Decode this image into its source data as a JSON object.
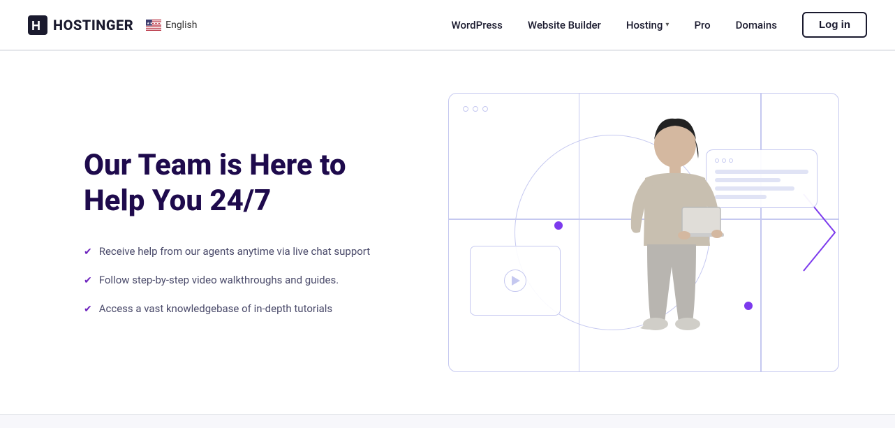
{
  "navbar": {
    "logo_text": "HOSTINGER",
    "language": "English",
    "nav_links": [
      {
        "label": "WordPress",
        "id": "wordpress"
      },
      {
        "label": "Website Builder",
        "id": "website-builder"
      },
      {
        "label": "Hosting",
        "id": "hosting",
        "has_dropdown": true
      },
      {
        "label": "Pro",
        "id": "pro"
      },
      {
        "label": "Domains",
        "id": "domains"
      }
    ],
    "login_label": "Log in"
  },
  "hero": {
    "title": "Our Team is Here to Help You 24/7",
    "features": [
      {
        "text": "Receive help from our agents anytime via live chat support"
      },
      {
        "text": "Follow step-by-step video walkthroughs and guides."
      },
      {
        "text": "Access a vast knowledgebase of in-depth tutorials"
      }
    ]
  },
  "illustration": {
    "browser_dots": [
      "dot1",
      "dot2",
      "dot3"
    ],
    "check_icon": "✔",
    "chat_lines": [
      100,
      70,
      85,
      55
    ]
  },
  "colors": {
    "accent_purple": "#7c3aed",
    "nav_border": "#1a1a2e",
    "title_color": "#1e0a4c",
    "feature_color": "#4a4a6a",
    "check_color": "#6c22bd",
    "illustration_border": "#c5c8f0"
  }
}
